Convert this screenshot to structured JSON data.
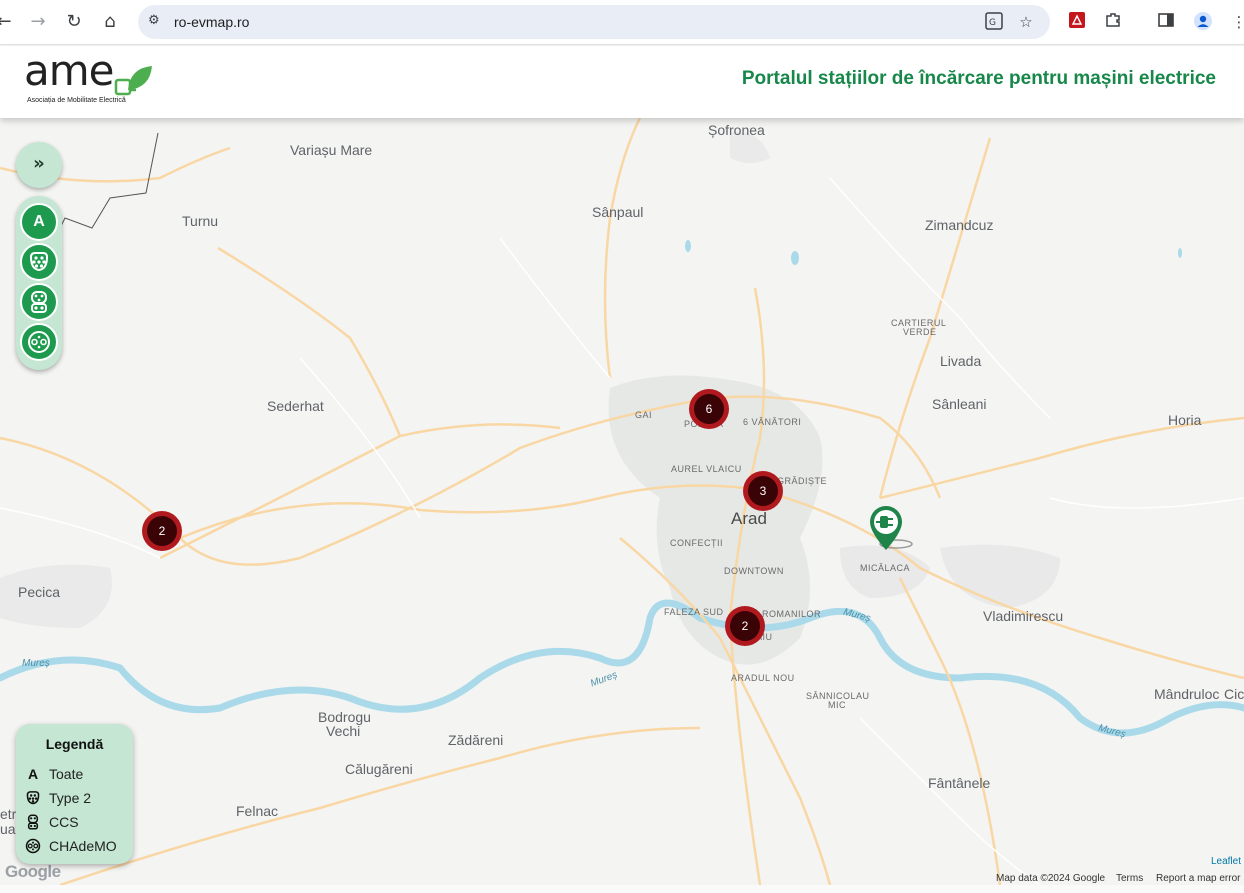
{
  "browser": {
    "url": "ro-evmap.ro",
    "back_icon": "arrow-left-icon",
    "forward_icon": "arrow-right-icon",
    "reload_icon": "reload-icon",
    "home_icon": "home-icon"
  },
  "header": {
    "logo_text": "ame",
    "logo_sub": "Asociația de Mobilitate Electrică",
    "title": "Portalul stațiilor de încărcare pentru mașini electrice"
  },
  "controls": {
    "toggle_label": "»",
    "filters": [
      {
        "label": "A",
        "icon": "all-icon"
      },
      {
        "label": "",
        "icon": "type2-connector-icon"
      },
      {
        "label": "",
        "icon": "ccs-connector-icon"
      },
      {
        "label": "",
        "icon": "chademo-connector-icon"
      }
    ]
  },
  "legend": {
    "title": "Legendă",
    "items": [
      {
        "symbol": "A",
        "label": "Toate"
      },
      {
        "symbol": "",
        "label": "Type 2"
      },
      {
        "symbol": "",
        "label": "CCS"
      },
      {
        "symbol": "",
        "label": "CHAdeMO"
      }
    ]
  },
  "map": {
    "places": [
      {
        "name": "Variașu Mare"
      },
      {
        "name": "Turnu"
      },
      {
        "name": "Sânpaul"
      },
      {
        "name": "Zimandcuz"
      },
      {
        "name": "Sederhat"
      },
      {
        "name": "CARTIERUL"
      },
      {
        "name": "VERDE"
      },
      {
        "name": "Livada"
      },
      {
        "name": "Sânleani"
      },
      {
        "name": "Horia"
      },
      {
        "name": "GAI"
      },
      {
        "name": "POPASA"
      },
      {
        "name": "6 VÂNĂTORI"
      },
      {
        "name": "AUREL VLAICU"
      },
      {
        "name": "GRĂDIȘTE"
      },
      {
        "name": "Arad"
      },
      {
        "name": "CONFECȚII"
      },
      {
        "name": "MICĂLACA"
      },
      {
        "name": "DOWNTOWN"
      },
      {
        "name": "FALEZA SUD"
      },
      {
        "name": "ROMANILOR"
      },
      {
        "name": "MIHAIU"
      },
      {
        "name": "Vladimirescu"
      },
      {
        "name": "Pecica"
      },
      {
        "name": "Mureș"
      },
      {
        "name": "Mureș"
      },
      {
        "name": "Mureș"
      },
      {
        "name": "Mureș"
      },
      {
        "name": "ARADUL NOU"
      },
      {
        "name": "SÂNNICOLAU"
      },
      {
        "name": "MIC"
      },
      {
        "name": "Mândruloc"
      },
      {
        "name": "Cic"
      },
      {
        "name": "Bodrogu"
      },
      {
        "name": "Vechi"
      },
      {
        "name": "Zădăreni"
      },
      {
        "name": "Călugăreni"
      },
      {
        "name": "Fântânele"
      },
      {
        "name": "Felnac"
      },
      {
        "name": "Șofronea"
      },
      {
        "name": "etru"
      },
      {
        "name": "uan"
      }
    ],
    "clusters": [
      {
        "count": "6"
      },
      {
        "count": "3"
      },
      {
        "count": "2"
      },
      {
        "count": "2"
      }
    ],
    "station_icon": "charging-station-pin-icon"
  },
  "attribution": {
    "google": "Google",
    "map_data": "Map data ©2024 Google",
    "terms": "Terms",
    "report": "Report a map error",
    "leaflet": "Leaflet"
  },
  "colors": {
    "accent_green": "#1d9a4e",
    "title_green": "#17874a",
    "panel_green": "#c4e6d2",
    "cluster_red": "#b0191e",
    "river": "#aadaea",
    "road": "#f9d7a4"
  }
}
